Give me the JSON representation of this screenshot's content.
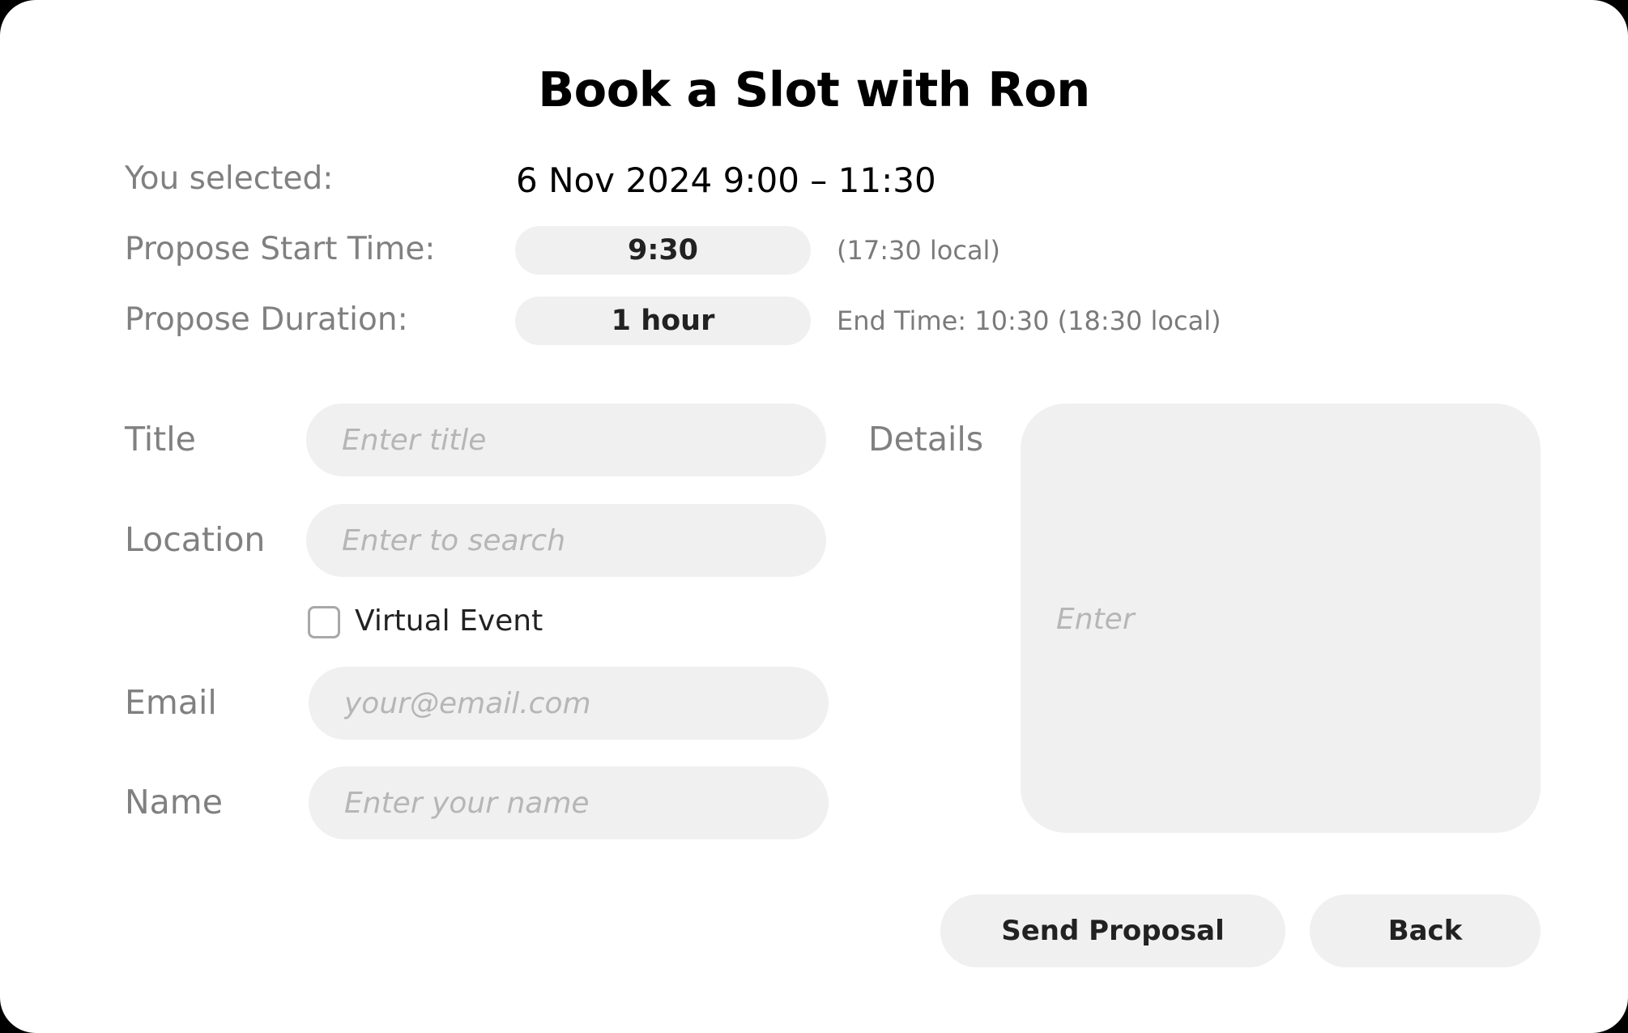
{
  "header": {
    "title": "Book a Slot with Ron"
  },
  "selection": {
    "selected_label": "You selected:",
    "selected_value": "6 Nov 2024 9:00 – 11:30",
    "start_label": "Propose Start Time:",
    "start_value": "9:30",
    "start_note": "(17:30 local)",
    "duration_label": "Propose Duration:",
    "duration_value": "1 hour",
    "end_note": "End Time: 10:30 (18:30 local)"
  },
  "form": {
    "title_label": "Title",
    "title_placeholder": "Enter title",
    "location_label": "Location",
    "location_placeholder": "Enter to search",
    "virtual_label": "Virtual Event",
    "virtual_checked": false,
    "email_label": "Email",
    "email_placeholder": "your@email.com",
    "name_label": "Name",
    "name_placeholder": "Enter your name",
    "details_label": "Details",
    "details_placeholder": "Enter"
  },
  "actions": {
    "send_label": "Send Proposal",
    "back_label": "Back"
  }
}
